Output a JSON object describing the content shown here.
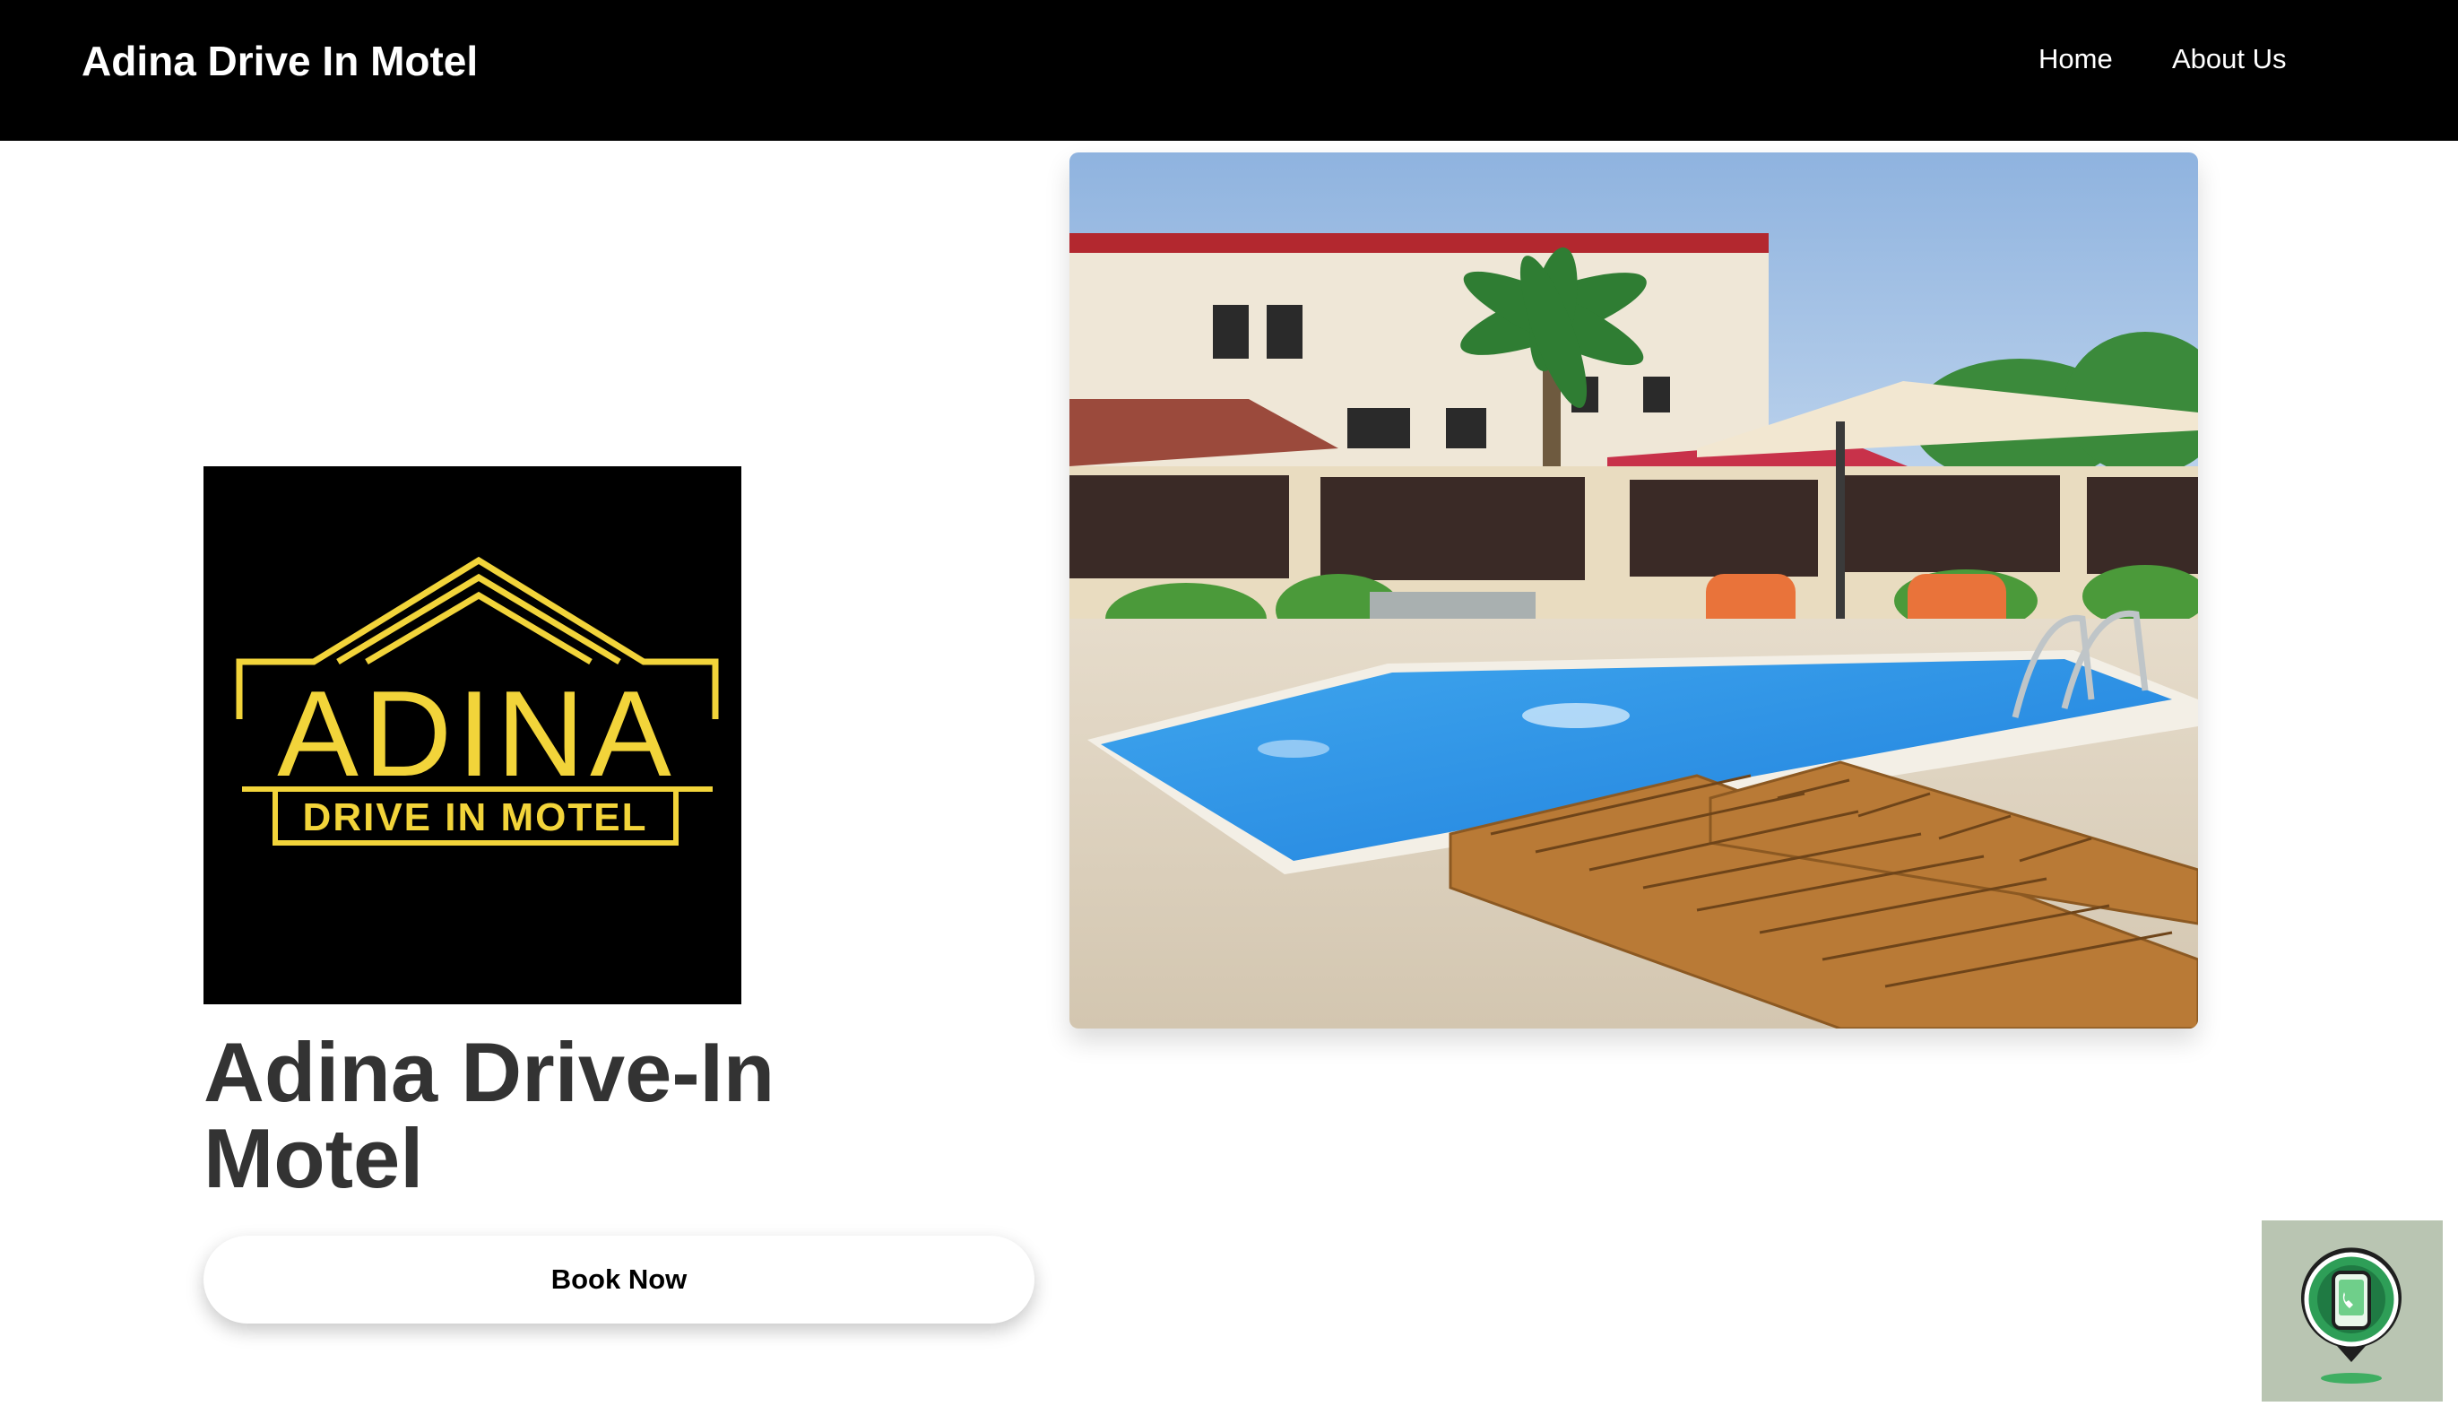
{
  "navbar": {
    "brand": "Adina Drive In Motel",
    "links": [
      {
        "label": "Home"
      },
      {
        "label": "About Us"
      }
    ]
  },
  "hero": {
    "logo": {
      "wordmark": "ADINA",
      "tagline": "DRIVE IN MOTEL",
      "accent_color": "#f2d43a",
      "background": "#000000"
    },
    "title": "Adina Drive-In Motel",
    "cta_label": "Book Now"
  },
  "photo": {
    "subject": "swimming pool with wooden sun loungers, parasol and orange chairs"
  },
  "floating_widget": {
    "icon": "phone-call-icon",
    "color": "#2e9e57"
  },
  "theme": {
    "navbar_bg": "#000000",
    "title_color": "#333333"
  }
}
